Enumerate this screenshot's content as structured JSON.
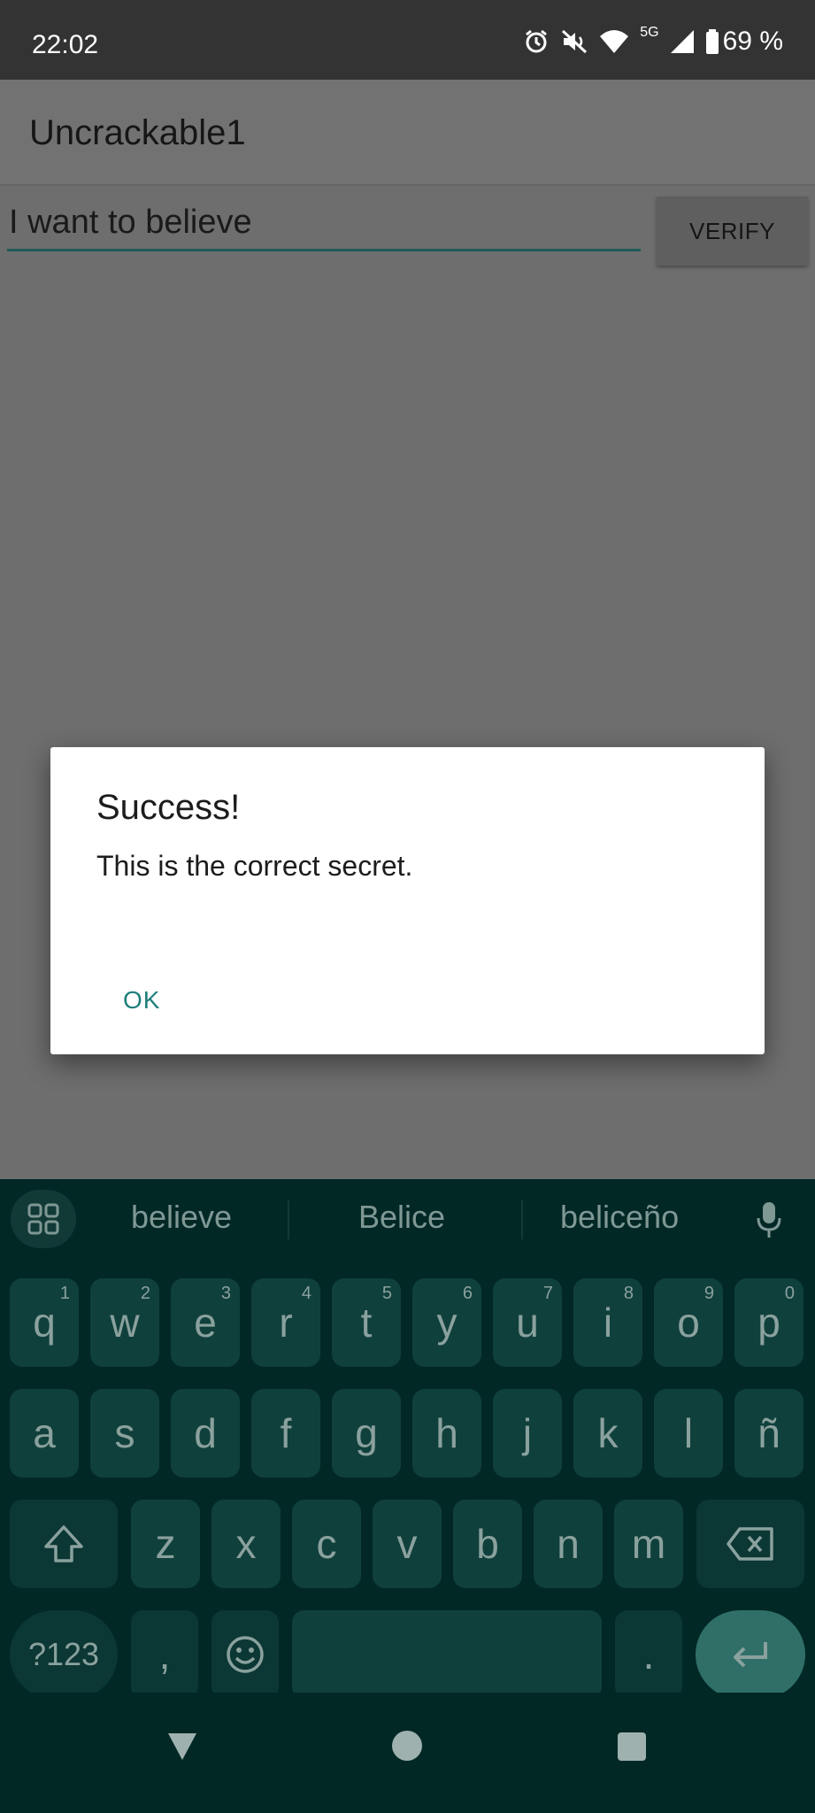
{
  "status_bar": {
    "time": "22:02",
    "network_label": "5G",
    "battery": "69 %",
    "icons": [
      "alarm-icon",
      "mute-icon",
      "wifi-icon",
      "signal-icon",
      "battery-icon"
    ]
  },
  "app": {
    "title": "Uncrackable1",
    "input_value": "I want to believe",
    "verify_label": "VERIFY"
  },
  "dialog": {
    "title": "Success!",
    "message": "This is the correct secret.",
    "ok_label": "OK"
  },
  "keyboard": {
    "suggestions": [
      "believe",
      "Belice",
      "beliceño"
    ],
    "row1": [
      {
        "k": "q",
        "n": "1"
      },
      {
        "k": "w",
        "n": "2"
      },
      {
        "k": "e",
        "n": "3"
      },
      {
        "k": "r",
        "n": "4"
      },
      {
        "k": "t",
        "n": "5"
      },
      {
        "k": "y",
        "n": "6"
      },
      {
        "k": "u",
        "n": "7"
      },
      {
        "k": "i",
        "n": "8"
      },
      {
        "k": "o",
        "n": "9"
      },
      {
        "k": "p",
        "n": "0"
      }
    ],
    "row2": [
      "a",
      "s",
      "d",
      "f",
      "g",
      "h",
      "j",
      "k",
      "l",
      "ñ"
    ],
    "row3": [
      "z",
      "x",
      "c",
      "v",
      "b",
      "n",
      "m"
    ],
    "symbols_label": "?123",
    "comma_label": ",",
    "period_label": "."
  },
  "colors": {
    "accent": "#1f7f7a",
    "keyboard_bg": "#022826",
    "key_bg": "#10403c",
    "enter_bg": "#2f6f68"
  }
}
